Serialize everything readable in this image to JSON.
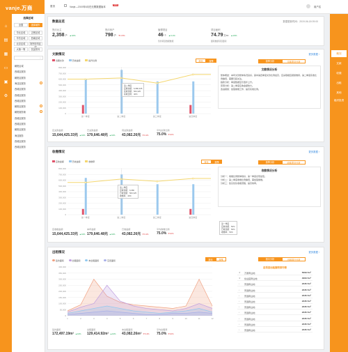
{
  "app": {
    "logo": "vanje.万商",
    "breadcrumb_home": "首页",
    "notice": "Vanje—2019年6月在无需数据版本",
    "notice_badge": "NEW"
  },
  "user": {
    "name": "用户名"
  },
  "sidebar": {
    "title": "选择区域",
    "tabs": [
      "全国",
      "选择城市"
    ],
    "region_rows": [
      [
        "华北区域",
        "正餐区域"
      ],
      [
        "华东区域",
        "西南区域"
      ],
      [
        "北京区域",
        "场所影响区域"
      ],
      [
        "大第一等",
        "饮品系列"
      ]
    ],
    "search_placeholder": "",
    "items": [
      "朝阳区域",
      "西城区服务",
      "朝阳区服务",
      "海淀区服务",
      "西城区服务",
      "西城区服务",
      "西城区服务",
      "朝阳区服务",
      "朝阳服务管",
      "西城区服务",
      "西城区服务",
      "朝阳区服务",
      "海淀服务",
      "西城区服务",
      "西城区服务"
    ]
  },
  "rightrail": {
    "items": [
      "概况",
      "文款",
      "收缴",
      "出租",
      "其他",
      "组织投资"
    ]
  },
  "overview": {
    "title": "数据总览",
    "timestamp": "数据更新时间：2019-06-18 09:00",
    "kpis": [
      {
        "label": "签约业主",
        "value": "2,358",
        "unit": "户",
        "delta": "10%",
        "dir": "up",
        "note": ""
      },
      {
        "label": "签约商户",
        "value": "798",
        "unit": "户",
        "delta": "4.5%",
        "dir": "down",
        "note": ""
      },
      {
        "label": "管理项目",
        "value": "46",
        "unit": "个",
        "delta": "0.1%",
        "dir": "up",
        "note": "签约项目数据数据"
      },
      {
        "label": "项目面积",
        "value": "74.79",
        "unit": "万m²",
        "delta": "10%",
        "dir": "up",
        "note": "面积数据项目面积"
      }
    ]
  },
  "section1": {
    "title": "文款情况",
    "link": "更多数据 ›",
    "legend": [
      "当期文款",
      "已收金额",
      "提升比例"
    ],
    "tabs": [
      "按月",
      "按季"
    ],
    "kpis": [
      {
        "label": "应文款金额",
        "value": "15,644,425.33元",
        "delta": "10%",
        "dir": "up"
      },
      {
        "label": "已文款金额",
        "value": "179,646.48元",
        "delta": "10%",
        "dir": "up"
      },
      {
        "label": "待文款金额",
        "value": "43,082.26元",
        "delta": "0.4%",
        "dir": "down"
      },
      {
        "label": "平均文款比例",
        "value": "75.0%",
        "delta": "10%",
        "dir": "down"
      }
    ],
    "tooltip": [
      "第二季度",
      "应收金额：6,680,325",
      "实收金额：560,325",
      "实收比例：40%"
    ],
    "insight": {
      "title": "文款情况分析",
      "btn_on": "按季分析",
      "btn_off": "文款项目分析",
      "lines": [
        "整体概述：本年文款整体情况良好，其中第四季度文款比例最高，应采取相应措施维持，第二季度实收比例偏低，需要引起关注。",
        "趋势分析：季度数据显示逐步上升。",
        "原因分析：第二季度应收金额较大。",
        "改进措施：加强催缴工作，提高实收比例。"
      ]
    }
  },
  "section2": {
    "title": "收缴情况",
    "link": "更多数据 ›",
    "legend": [
      "应收金额",
      "已收金额",
      "收缴率"
    ],
    "tabs": [
      "按月",
      "按季"
    ],
    "kpis": [
      {
        "label": "应收缴金额",
        "value": "15,644,425.33元",
        "delta": "10%",
        "dir": "up"
      },
      {
        "label": "本年金额",
        "value": "179,646.48元",
        "delta": "10%",
        "dir": "up"
      },
      {
        "label": "已收金额",
        "value": "43,082.26元",
        "delta": "0.4%",
        "dir": "down"
      },
      {
        "label": "平均收缴比例",
        "value": "75.0%",
        "delta": "10%",
        "dir": "down"
      }
    ],
    "tooltip": [
      "第二季度",
      "应收金额：6,680",
      "已收金额：560,325",
      "收缴率：40%"
    ],
    "tooltip2": [
      "第一季度",
      "应收金额：50%",
      "已收金额：50%",
      "收缴率：50%"
    ],
    "insight": {
      "title": "收款情况分析",
      "btn_on": "按季分析",
      "btn_off": "收款项目分析",
      "lines": [
        "分析一：收缴比例整体较好，第一季度表现最佳。",
        "分析二：第二季度收缴比例偏低，需加强催缴。",
        "分析三：建议优化收缴流程，提高效率。"
      ]
    }
  },
  "section3": {
    "title": "出租情况",
    "link": "更多数据 ›",
    "legend": [
      "签约面积",
      "出租面积",
      "未出租面积",
      "空置面积"
    ],
    "tabs": [
      "按月",
      "按季"
    ],
    "kpis": [
      {
        "label": "签约面积",
        "value": "172,497.19m²",
        "delta": "10%",
        "dir": "up"
      },
      {
        "label": "出租面积",
        "value": "129,414.92m²",
        "delta": "10%",
        "dir": "up"
      },
      {
        "label": "未出租面积",
        "value": "43,082.26m²",
        "delta": "0.4%",
        "dir": "down"
      },
      {
        "label": "平均出租率",
        "value": "75.0%",
        "delta": "10%",
        "dir": "down"
      }
    ],
    "ranking": {
      "btn_on": "按月分析",
      "btn_off": "出租排行分析",
      "title": "各项目出租面积排行榜",
      "rows": [
        [
          "万豪商业地",
          "5009.7m²"
        ],
        [
          "创业园商业地",
          "4000.7m²"
        ],
        [
          "普通商业地",
          "2345.7m²"
        ],
        [
          "普通商业地",
          "2345.7m²"
        ],
        [
          "普通商业地",
          "2345.7m²"
        ],
        [
          "普通商业地",
          "2345.7m²"
        ],
        [
          "普通商业地",
          "2345.7m²"
        ],
        [
          "普通商业地",
          "2345.7m²"
        ],
        [
          "普通商业地",
          "2345.7m²"
        ],
        [
          "普通商业地",
          "2345.7m²"
        ],
        [
          "普通商业地",
          "2345.7m²"
        ]
      ]
    }
  },
  "colors": {
    "accent": "#f7941d",
    "bar_red": "#e0536a",
    "bar_blue": "#9cc9ee",
    "line_yellow": "#f5d76e",
    "up": "#1fa855",
    "down": "#e03c3c"
  },
  "chart_data": [
    {
      "type": "bar",
      "title": "文款情况",
      "categories": [
        "第一季度",
        "第二季度",
        "第三季度",
        "第四季度"
      ],
      "series": [
        {
          "name": "当期文款",
          "values": [
            150000,
            0,
            0,
            150000
          ]
        },
        {
          "name": "已收金额",
          "values": [
            600000,
            760000,
            560000,
            560000
          ]
        },
        {
          "name": "提升比例",
          "values": [
            600000,
            620000,
            530000,
            680000
          ]
        }
      ],
      "ylim": [
        0,
        800000
      ]
    },
    {
      "type": "bar",
      "title": "收缴情况",
      "categories": [
        "第一季度",
        "第二季度",
        "第三季度",
        "第四季度"
      ],
      "series": [
        {
          "name": "应收金额",
          "values": [
            100000,
            0,
            0,
            100000
          ]
        },
        {
          "name": "已收金额",
          "values": [
            640000,
            700000,
            530000,
            530000
          ]
        },
        {
          "name": "收缴率",
          "values": [
            560000,
            620000,
            580000,
            630000
          ]
        }
      ],
      "ylim": [
        0,
        800000
      ]
    },
    {
      "type": "area",
      "title": "出租情况",
      "categories": [
        "1",
        "2",
        "3",
        "4",
        "5",
        "6",
        "7",
        "8",
        "9",
        "10",
        "11",
        "12"
      ],
      "series": [
        {
          "name": "签约面积",
          "values": [
            40000,
            90000,
            300000,
            160000,
            110000,
            90000,
            80000,
            70000,
            60000,
            80000,
            300000,
            80000
          ]
        },
        {
          "name": "出租面积",
          "values": [
            30000,
            70000,
            100000,
            250000,
            120000,
            80000,
            60000,
            50000,
            40000,
            60000,
            100000,
            60000
          ]
        },
        {
          "name": "未出租面积",
          "values": [
            20000,
            40000,
            60000,
            80000,
            60000,
            40000,
            30000,
            20000,
            30000,
            40000,
            60000,
            30000
          ]
        },
        {
          "name": "空置面积",
          "values": [
            10000,
            20000,
            30000,
            40000,
            30000,
            20000,
            10000,
            10000,
            20000,
            20000,
            30000,
            20000
          ]
        }
      ],
      "ylim": [
        0,
        400000
      ]
    }
  ]
}
